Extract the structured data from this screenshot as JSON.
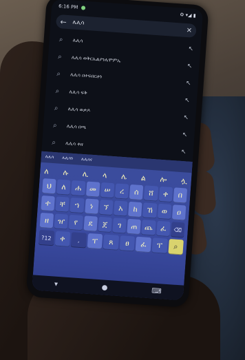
{
  "status_bar": {
    "time": "6:16 PM",
    "right_icons": "⚙ ▾◢ ▮"
  },
  "search": {
    "back_icon": "back-arrow-icon",
    "query": "ሌሊሳ",
    "clear_icon": "close-icon"
  },
  "suggestions": [
    {
      "text": "ሌሊሳ"
    },
    {
      "text": "ሌሊሳ ወቅርኤልያንሌሞምኤ"
    },
    {
      "text": "ሌሊሳ በተፍበርቶን"
    },
    {
      "text": "ሌሊሳ ፍቅ"
    },
    {
      "text": "ሌሊሳ ወቃዶ"
    },
    {
      "text": "ሌሊሳ በጫ"
    },
    {
      "text": "ሌሊሳ ቀዘ"
    }
  ],
  "keyboard": {
    "suggestion_strip": [
      "ሌሊሳ",
      "ሌሊሳን",
      "ሌሊሳና"
    ],
    "top_chars": [
      "ለ",
      "ሉ",
      "ሊ",
      "ላ",
      "ሌ",
      "ል",
      "ሎ",
      "ሏ"
    ],
    "row1": [
      "ህ",
      "ለ",
      "ሐ",
      "መ",
      "ሠ",
      "ረ",
      "ሰ",
      "ሸ",
      "ቀ",
      "በ"
    ],
    "row2": [
      "ተ",
      "ቸ",
      "ኀ",
      "ነ",
      "ኘ",
      "አ",
      "ከ",
      "ኸ",
      "ወ",
      "ዐ"
    ],
    "row3": [
      "ዘ",
      "ዠ",
      "የ",
      "ደ",
      "ጀ",
      "ገ",
      "ጠ",
      "ጨ",
      "ፈ"
    ],
    "row4": [
      "?12",
      "ቀ",
      ",",
      "ፐ",
      "ጸ",
      "ፀ",
      "ፈ",
      "ፐ"
    ]
  }
}
